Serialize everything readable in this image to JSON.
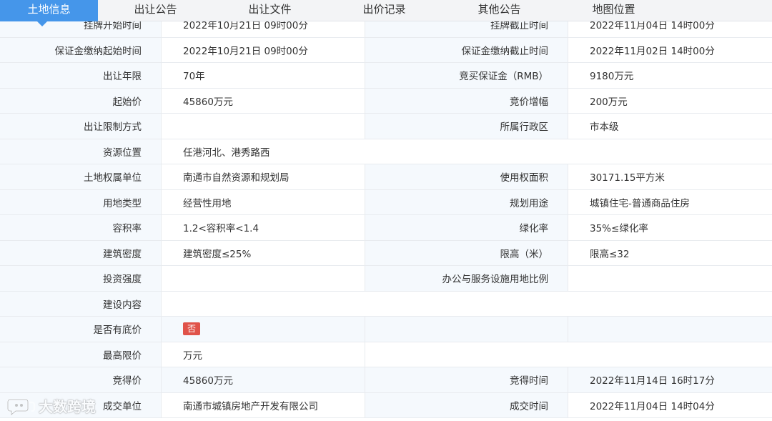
{
  "tabs": [
    {
      "label": "土地信息",
      "active": true
    },
    {
      "label": "出让公告"
    },
    {
      "label": "出让文件"
    },
    {
      "label": "出价记录"
    },
    {
      "label": "其他公告"
    },
    {
      "label": "地图位置"
    }
  ],
  "rows": {
    "r0": {
      "l1": "挂牌开始时间",
      "v1": "2022年10月21日 09时00分",
      "l2": "挂牌截止时间",
      "v2": "2022年11月04日 14时00分"
    },
    "r1": {
      "l1": "保证金缴纳起始时间",
      "v1": "2022年10月21日 09时00分",
      "l2": "保证金缴纳截止时间",
      "v2": "2022年11月02日 14时00分"
    },
    "r2": {
      "l1": "出让年限",
      "v1": "70年",
      "l2": "竞买保证金（RMB）",
      "v2": "9180万元"
    },
    "r3": {
      "l1": "起始价",
      "v1": "45860万元",
      "l2": "竞价增幅",
      "v2": "200万元"
    },
    "r4": {
      "l1": "出让限制方式",
      "v1": "",
      "l2": "所属行政区",
      "v2": "市本级"
    },
    "r5": {
      "l1": "资源位置",
      "v1": "任港河北、港秀路西"
    },
    "r6": {
      "l1": "土地权属单位",
      "v1": "南通市自然资源和规划局",
      "l2": "使用权面积",
      "v2": "30171.15平方米"
    },
    "r7": {
      "l1": "用地类型",
      "v1": "经营性用地",
      "l2": "规划用途",
      "v2": "城镇住宅-普通商品住房"
    },
    "r8": {
      "l1": "容积率",
      "v1": "1.2<容积率<1.4",
      "l2": "绿化率",
      "v2": "35%≤绿化率"
    },
    "r9": {
      "l1": "建筑密度",
      "v1": "建筑密度≤25%",
      "l2": "限高（米）",
      "v2": "限高≤32"
    },
    "r10": {
      "l1": "投资强度",
      "v1": "",
      "l2": "办公与服务设施用地比例",
      "v2": ""
    },
    "r11": {
      "l1": "建设内容",
      "v1": ""
    },
    "r12": {
      "l1": "是否有底价",
      "badge": "否",
      "l2": "",
      "v2": ""
    },
    "r13": {
      "l1": "最高限价",
      "v1": "万元"
    },
    "r14": {
      "l1": "竞得价",
      "v1": "45860万元",
      "l2": "竞得时间",
      "v2": "2022年11月14日 16时17分"
    },
    "r15": {
      "l1": "成交单位",
      "v1": "南通市城镇房地产开发有限公司",
      "l2": "成交时间",
      "v2": "2022年11月04日 14时04分"
    }
  },
  "watermark": {
    "text": "大数跨境",
    "icon": "chat-bubble-icon"
  },
  "colors": {
    "tab_active": "#4596ea",
    "label_bg": "#f5f9fd",
    "badge": "#e0534a"
  }
}
